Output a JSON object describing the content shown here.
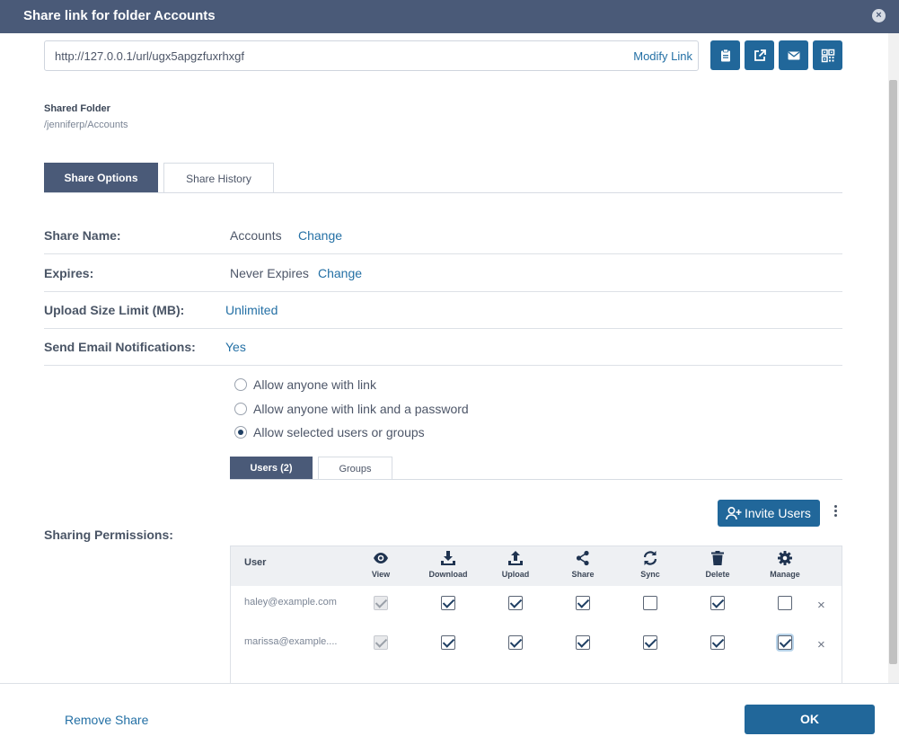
{
  "dialog": {
    "title": "Share link for folder Accounts",
    "close_glyph": "×"
  },
  "link": {
    "url": "http://127.0.0.1/url/ugx5apgzfuxrhxgf",
    "modify_label": "Modify Link",
    "actions": [
      "clipboard-icon",
      "open-external-icon",
      "email-icon",
      "qr-code-icon"
    ]
  },
  "folder": {
    "label": "Shared Folder",
    "path": "/jenniferp/Accounts"
  },
  "tabs": [
    {
      "label": "Share Options",
      "active": true
    },
    {
      "label": "Share History",
      "active": false
    }
  ],
  "options": {
    "share_name": {
      "label": "Share Name:",
      "value": "Accounts",
      "action": "Change"
    },
    "expires": {
      "label": "Expires:",
      "value": "Never Expires",
      "action": "Change"
    },
    "upload_limit": {
      "label": "Upload Size Limit (MB):",
      "value": "Unlimited"
    },
    "email_notifications": {
      "label": "Send Email Notifications:",
      "value": "Yes"
    }
  },
  "access": {
    "options": [
      {
        "label": "Allow anyone with link",
        "selected": false
      },
      {
        "label": "Allow anyone with link and a password",
        "selected": false
      },
      {
        "label": "Allow selected users or groups",
        "selected": true
      }
    ]
  },
  "subtabs": [
    {
      "label": "Users (2)",
      "active": true
    },
    {
      "label": "Groups",
      "active": false
    }
  ],
  "permissions": {
    "label": "Sharing Permissions:",
    "invite_label": "Invite Users",
    "user_header": "User",
    "columns": [
      {
        "label": "View",
        "icon": "eye-icon"
      },
      {
        "label": "Download",
        "icon": "download-icon"
      },
      {
        "label": "Upload",
        "icon": "upload-icon"
      },
      {
        "label": "Share",
        "icon": "share-icon"
      },
      {
        "label": "Sync",
        "icon": "sync-icon"
      },
      {
        "label": "Delete",
        "icon": "trash-icon"
      },
      {
        "label": "Manage",
        "icon": "gear-icon"
      }
    ],
    "users": [
      {
        "email": "haley@example.com",
        "perms": [
          true,
          true,
          true,
          true,
          false,
          true,
          false
        ]
      },
      {
        "email": "marissa@example....",
        "perms": [
          true,
          true,
          true,
          true,
          true,
          true,
          true
        ]
      }
    ],
    "remove_glyph": "×"
  },
  "footer": {
    "remove_label": "Remove Share",
    "ok_label": "OK"
  },
  "colors": {
    "header": "#4a5a78",
    "primary": "#21679a",
    "link": "#2470a5"
  }
}
